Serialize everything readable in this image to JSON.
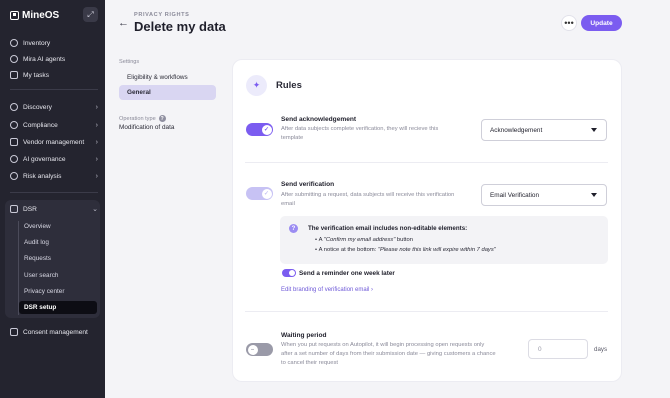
{
  "sidebar": {
    "brand": "MineOS",
    "top_items": [
      {
        "label": "Inventory"
      },
      {
        "label": "Mira AI agents"
      },
      {
        "label": "My tasks"
      }
    ],
    "groups": [
      {
        "label": "Discovery"
      },
      {
        "label": "Compliance"
      },
      {
        "label": "Vendor management"
      },
      {
        "label": "AI governance"
      },
      {
        "label": "Risk analysis"
      }
    ],
    "dsr": {
      "label": "DSR",
      "items": [
        {
          "label": "Overview"
        },
        {
          "label": "Audit log"
        },
        {
          "label": "Requests"
        },
        {
          "label": "User search"
        },
        {
          "label": "Privacy center"
        },
        {
          "label": "DSR setup",
          "active": true
        }
      ]
    },
    "consent": "Consent management"
  },
  "header": {
    "overline": "PRIVACY RIGHTS",
    "title": "Delete my data",
    "more": "•••",
    "update": "Update"
  },
  "settings_nav": {
    "label": "Settings",
    "items": [
      {
        "label": "Eligibility & workflows"
      },
      {
        "label": "General",
        "active": true
      }
    ],
    "operation_type_label": "Operation type",
    "operation_type_value": "Modification of data"
  },
  "rules": {
    "title": "Rules",
    "acknowledgement": {
      "title": "Send acknowledgement",
      "desc_line1": "After data subjects complete verification, they will recieve this",
      "desc_line2": "template",
      "select_value": "Acknowledgement",
      "enabled": true
    },
    "verification": {
      "title": "Send verification",
      "desc_line1": "After submitting a request, data subjects will receive this verification",
      "desc_line2": "email",
      "select_value": "Email Verification",
      "enabled": true,
      "notice_title": "The verification email includes non-editable elements:",
      "bullet1_prefix": "A ",
      "bullet1_italic": "\"Confirm my email address\"",
      "bullet1_suffix": " button",
      "bullet2_prefix": "A notice at the bottom: ",
      "bullet2_italic": "\"Please note this link will expire within 7 days\"",
      "reminder": "Send a reminder one week later",
      "edit_link": "Edit branding of verification email ›"
    },
    "waiting": {
      "title": "Waiting period",
      "desc_line1": "When you put requests on Autopilot, it will begin processing open requests only",
      "desc_line2": "after a set number of days from their submission date — giving customers a chance",
      "desc_line3": "to cancel their request",
      "input_value": "0",
      "unit": "days",
      "enabled": false
    }
  },
  "colors": {
    "accent": "#7b5cf0",
    "sidebar_bg": "#24242f",
    "selected_nav": "#d9d6f2"
  }
}
